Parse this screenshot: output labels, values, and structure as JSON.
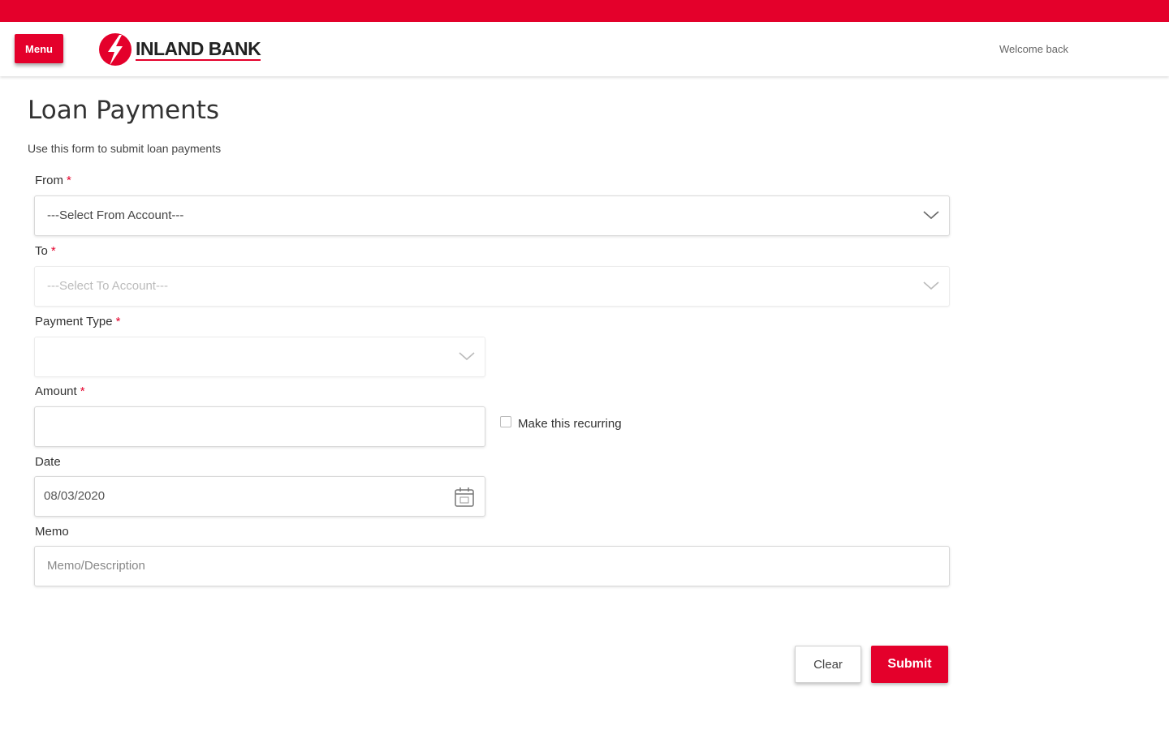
{
  "header": {
    "menu_label": "Menu",
    "brand": "INLAND BANK",
    "welcome": "Welcome back"
  },
  "page": {
    "title": "Loan Payments",
    "subtitle": "Use this form to submit loan payments"
  },
  "form": {
    "from": {
      "label": "From",
      "required_mark": "*",
      "value": "---Select From Account---"
    },
    "to": {
      "label": "To",
      "required_mark": "*",
      "value": "---Select To Account---"
    },
    "payment_type": {
      "label": "Payment Type",
      "required_mark": "*",
      "value": ""
    },
    "amount": {
      "label": "Amount",
      "required_mark": "*",
      "value": ""
    },
    "recurring": {
      "label": "Make this recurring",
      "checked": false
    },
    "date": {
      "label": "Date",
      "value": "08/03/2020"
    },
    "memo": {
      "label": "Memo",
      "placeholder": "Memo/Description",
      "value": ""
    }
  },
  "actions": {
    "clear_label": "Clear",
    "submit_label": "Submit"
  },
  "colors": {
    "brand_red": "#e4002b"
  },
  "icons": [
    "chevron-down-icon",
    "calendar-icon",
    "bank-logo-icon"
  ]
}
